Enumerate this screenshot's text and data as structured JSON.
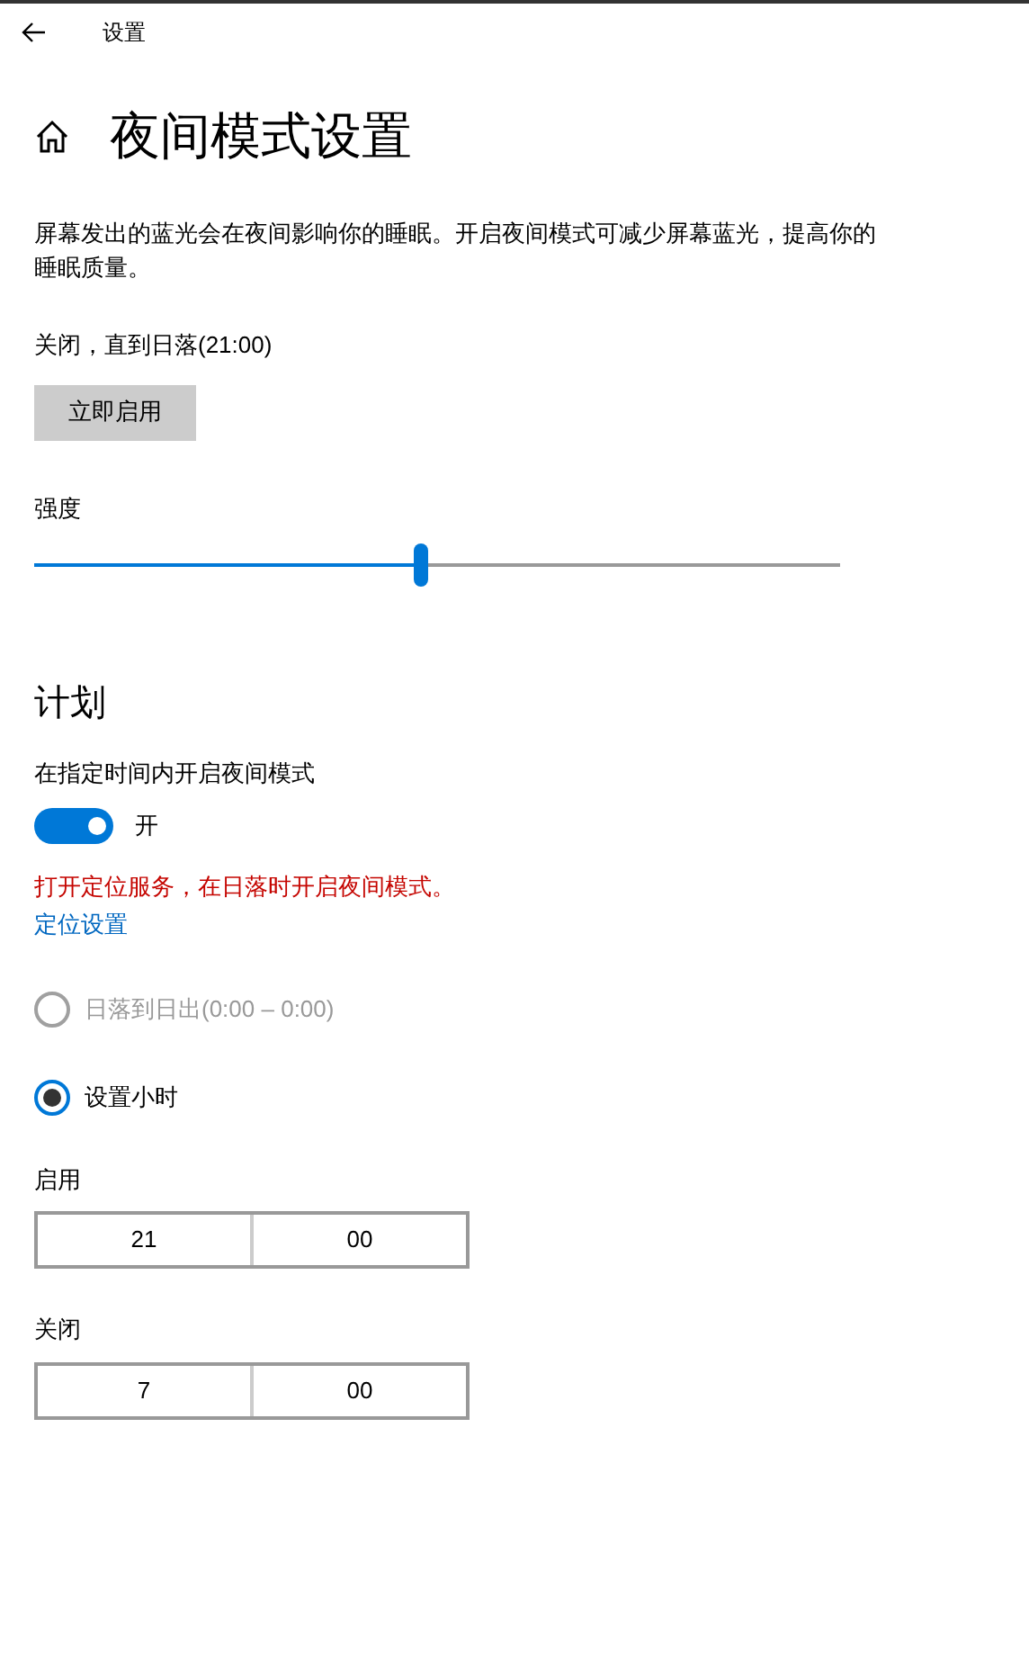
{
  "window": {
    "title": "设置"
  },
  "page": {
    "title": "夜间模式设置"
  },
  "description": "屏幕发出的蓝光会在夜间影响你的睡眠。开启夜间模式可减少屏幕蓝光，提高你的睡眠质量。",
  "status": "关闭，直到日落(21:00)",
  "enable_button": "立即启用",
  "strength": {
    "label": "强度",
    "level": 0.48
  },
  "schedule": {
    "heading": "计划",
    "toggle_label": "在指定时间内开启夜间模式",
    "on": true,
    "toggle_text": "开",
    "warning": "打开定位服务，在日落时开启夜间模式。",
    "link": "定位设置",
    "options": [
      {
        "label": "日落到日出(0:00 – 0:00)",
        "selected": false,
        "disabled": true
      },
      {
        "label": "设置小时",
        "selected": true,
        "disabled": false
      }
    ],
    "times": [
      {
        "label": "启用",
        "hour": "21",
        "minute": "00"
      },
      {
        "label": "关闭",
        "hour": "7",
        "minute": "00"
      }
    ]
  }
}
